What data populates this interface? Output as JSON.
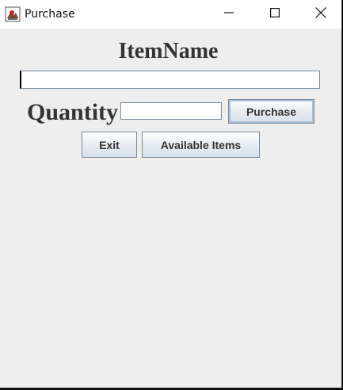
{
  "window": {
    "title": "Purchase",
    "icon": "java-app-icon",
    "controls": {
      "minimize_icon": "minimize-icon",
      "maximize_icon": "maximize-icon",
      "close_icon": "close-icon"
    }
  },
  "form": {
    "item_name_label": "ItemName",
    "item_name_value": "",
    "quantity_label": "Quantity",
    "quantity_value": ""
  },
  "buttons": {
    "purchase": "Purchase",
    "exit": "Exit",
    "available_items": "Available Items"
  },
  "colors": {
    "background": "#eeeeee",
    "label_text": "#333333",
    "button_border": "#7a8a99",
    "titlebar": "#ffffff"
  }
}
